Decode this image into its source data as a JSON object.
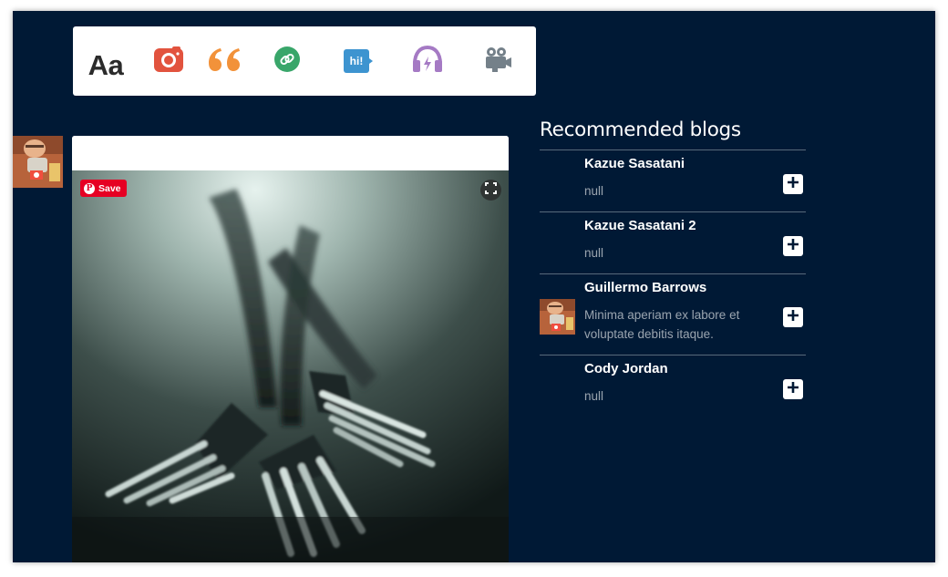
{
  "post_toolbar": {
    "items": [
      {
        "name": "text-post-button",
        "label": "Aa",
        "icon": "text-icon",
        "color": "#2b2b2b"
      },
      {
        "name": "photo-post-button",
        "icon": "camera-icon",
        "color": "#e2533e"
      },
      {
        "name": "quote-post-button",
        "icon": "quote-icon",
        "color": "#f2923a"
      },
      {
        "name": "link-post-button",
        "icon": "link-icon",
        "color": "#39a66a"
      },
      {
        "name": "chat-post-button",
        "label": "hi!",
        "icon": "chat-icon",
        "color": "#3d94d0"
      },
      {
        "name": "audio-post-button",
        "icon": "headphones-icon",
        "color": "#a57ac4"
      },
      {
        "name": "video-post-button",
        "icon": "video-camera-icon",
        "color": "#748089"
      }
    ]
  },
  "post": {
    "pinterest_save_label": "Save"
  },
  "recommended": {
    "title": "Recommended blogs",
    "blogs": [
      {
        "name": "Kazue Sasatani",
        "description": "null",
        "has_avatar": false
      },
      {
        "name": "Kazue Sasatani 2",
        "description": "null",
        "has_avatar": false
      },
      {
        "name": "Guillermo Barrows",
        "description": "Minima aperiam ex labore et voluptate debitis itaque.",
        "has_avatar": true
      },
      {
        "name": "Cody Jordan",
        "description": "null",
        "has_avatar": false
      }
    ]
  },
  "colors": {
    "background": "#001935",
    "pinterest_red": "#e60023"
  }
}
